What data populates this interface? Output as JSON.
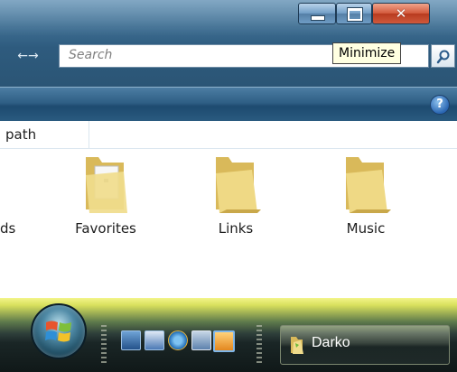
{
  "window": {
    "caption_buttons": {
      "minimize": "minimize-icon",
      "maximize": "maximize-icon",
      "close": "✕"
    },
    "nav_arrow": "←→",
    "search": {
      "placeholder": "Search",
      "icon": "search-icon"
    },
    "tooltip": "Minimize",
    "help": "?",
    "columns": {
      "first": "path"
    },
    "cut_label": "ds",
    "folders": [
      {
        "label": "Favorites",
        "icon": "folder-favorites-icon"
      },
      {
        "label": "Links",
        "icon": "folder-icon"
      },
      {
        "label": "Music",
        "icon": "folder-icon"
      }
    ]
  },
  "taskbar": {
    "start_orb": "windows-logo-icon",
    "quick_launch": [
      "desktop-icon",
      "switch-windows-icon",
      "internet-explorer-icon",
      "network-icon",
      "media-player-icon"
    ],
    "task_button": {
      "label": "Darko",
      "icon": "folder-icon"
    }
  },
  "colors": {
    "accent": "#2e5b7e",
    "taskbar_top": "#d7df5c",
    "folder": "#e9d27a"
  }
}
